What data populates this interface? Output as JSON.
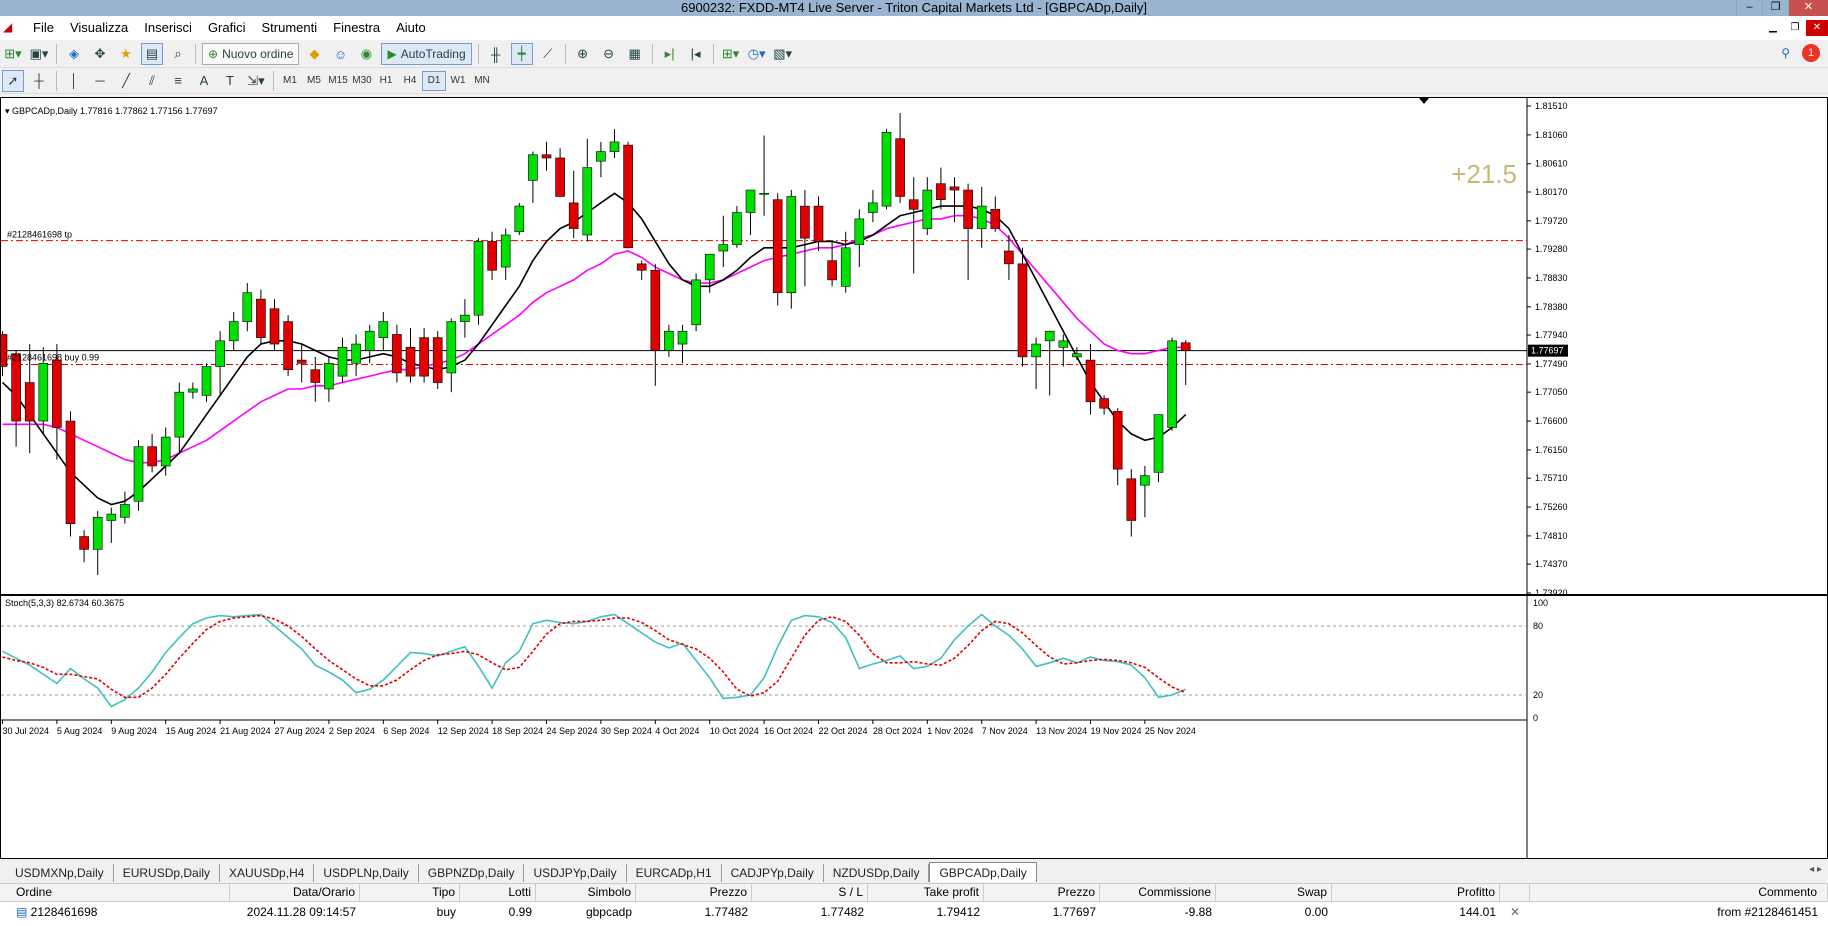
{
  "window": {
    "title": "6900232: FXDD-MT4 Live Server - Triton Capital Markets Ltd - [GBPCADp,Daily]",
    "controls": [
      "–",
      "❐",
      "✕"
    ]
  },
  "menu": {
    "items": [
      "File",
      "Visualizza",
      "Inserisci",
      "Grafici",
      "Strumenti",
      "Finestra",
      "Aiuto"
    ]
  },
  "toolbar": {
    "new_order_label": "Nuovo ordine",
    "autotrading_label": "AutoTrading",
    "timeframes": [
      "M1",
      "M5",
      "M15",
      "M30",
      "H1",
      "H4",
      "D1",
      "W1",
      "MN"
    ],
    "active_timeframe": "D1",
    "alert_count": "1"
  },
  "chart": {
    "header": "GBPCADp,Daily  1.77816 1.77862 1.77156 1.77697",
    "tp_label": "#2128461698 tp",
    "buy_label": "#2128461698 buy 0.99",
    "profit_label": "+21.5",
    "stoch_header": "Stoch(5,3,3) 82.6734 60.3675",
    "current_price": "1.77697",
    "price_labels": [
      "1.81510",
      "1.81060",
      "1.80610",
      "1.80170",
      "1.79720",
      "1.79280",
      "1.78830",
      "1.78380",
      "1.77940",
      "1.77490",
      "1.77050",
      "1.76600",
      "1.76150",
      "1.75710",
      "1.75260",
      "1.74810",
      "1.74370",
      "1.73920"
    ],
    "stoch_labels": [
      "100",
      "80",
      "20",
      "0"
    ],
    "date_labels": [
      "30 Jul 2024",
      "5 Aug 2024",
      "9 Aug 2024",
      "15 Aug 2024",
      "21 Aug 2024",
      "27 Aug 2024",
      "2 Sep 2024",
      "6 Sep 2024",
      "12 Sep 2024",
      "18 Sep 2024",
      "24 Sep 2024",
      "30 Sep 2024",
      "4 Oct 2024",
      "10 Oct 2024",
      "16 Oct 2024",
      "22 Oct 2024",
      "28 Oct 2024",
      "1 Nov 2024",
      "7 Nov 2024",
      "13 Nov 2024",
      "19 Nov 2024",
      "25 Nov 2024"
    ],
    "colors": {
      "bull": "#00e000",
      "bear": "#e00000",
      "ma_fast": "#000000",
      "ma_slow": "#ff00ff",
      "stoch_main": "#40c0c0",
      "stoch_signal": "#e00000",
      "trade_line": "#e00000",
      "profit_text": "#c8b878"
    }
  },
  "chart_data": {
    "type": "candlestick",
    "symbol": "GBPCADp",
    "timeframe": "Daily",
    "ylim": [
      1.7392,
      1.8151
    ],
    "tp_level": 1.79412,
    "entry_level": 1.77482,
    "current_price": 1.77697,
    "candles": [
      [
        1.7795,
        1.78,
        1.773,
        1.7745
      ],
      [
        1.7765,
        1.777,
        1.762,
        1.766
      ],
      [
        1.772,
        1.778,
        1.761,
        1.766
      ],
      [
        1.766,
        1.7775,
        1.764,
        1.775
      ],
      [
        1.7755,
        1.778,
        1.76,
        1.765
      ],
      [
        1.766,
        1.7675,
        1.748,
        1.75
      ],
      [
        1.748,
        1.749,
        1.744,
        1.746
      ],
      [
        1.746,
        1.752,
        1.742,
        1.751
      ],
      [
        1.7505,
        1.7525,
        1.747,
        1.7515
      ],
      [
        1.751,
        1.755,
        1.75,
        1.753
      ],
      [
        1.7535,
        1.763,
        1.752,
        1.762
      ],
      [
        1.762,
        1.764,
        1.758,
        1.759
      ],
      [
        1.759,
        1.765,
        1.7575,
        1.7635
      ],
      [
        1.7635,
        1.772,
        1.761,
        1.7705
      ],
      [
        1.7705,
        1.772,
        1.7695,
        1.771
      ],
      [
        1.77,
        1.775,
        1.769,
        1.7745
      ],
      [
        1.7745,
        1.78,
        1.77,
        1.7785
      ],
      [
        1.7785,
        1.783,
        1.777,
        1.7815
      ],
      [
        1.7815,
        1.7875,
        1.78,
        1.786
      ],
      [
        1.785,
        1.7865,
        1.778,
        1.779
      ],
      [
        1.7835,
        1.785,
        1.777,
        1.778
      ],
      [
        1.7815,
        1.7825,
        1.773,
        1.774
      ],
      [
        1.7755,
        1.778,
        1.772,
        1.775
      ],
      [
        1.774,
        1.776,
        1.769,
        1.772
      ],
      [
        1.771,
        1.776,
        1.769,
        1.775
      ],
      [
        1.773,
        1.779,
        1.772,
        1.7775
      ],
      [
        1.775,
        1.7795,
        1.773,
        1.778
      ],
      [
        1.777,
        1.781,
        1.775,
        1.78
      ],
      [
        1.779,
        1.783,
        1.777,
        1.7815
      ],
      [
        1.7795,
        1.781,
        1.772,
        1.7735
      ],
      [
        1.7775,
        1.7805,
        1.772,
        1.773
      ],
      [
        1.779,
        1.7805,
        1.772,
        1.773
      ],
      [
        1.779,
        1.78,
        1.771,
        1.772
      ],
      [
        1.7735,
        1.782,
        1.7705,
        1.7815
      ],
      [
        1.7815,
        1.785,
        1.779,
        1.7825
      ],
      [
        1.7825,
        1.7945,
        1.781,
        1.794
      ],
      [
        1.794,
        1.7955,
        1.788,
        1.7895
      ],
      [
        1.79,
        1.796,
        1.788,
        1.795
      ],
      [
        1.7955,
        1.8,
        1.795,
        1.7995
      ],
      [
        1.8035,
        1.808,
        1.8,
        1.8075
      ],
      [
        1.8075,
        1.8095,
        1.805,
        1.807
      ],
      [
        1.807,
        1.8085,
        1.801,
        1.801
      ],
      [
        1.8,
        1.805,
        1.7945,
        1.796
      ],
      [
        1.795,
        1.81,
        1.794,
        1.8055
      ],
      [
        1.8065,
        1.8095,
        1.804,
        1.808
      ],
      [
        1.808,
        1.8115,
        1.807,
        1.8095
      ],
      [
        1.809,
        1.8095,
        1.793,
        1.793
      ],
      [
        1.7905,
        1.791,
        1.788,
        1.7895
      ],
      [
        1.7895,
        1.7905,
        1.7715,
        1.777
      ],
      [
        1.777,
        1.781,
        1.776,
        1.78
      ],
      [
        1.778,
        1.781,
        1.775,
        1.78
      ],
      [
        1.781,
        1.789,
        1.78,
        1.788
      ],
      [
        1.788,
        1.792,
        1.786,
        1.792
      ],
      [
        1.7925,
        1.798,
        1.79,
        1.7935
      ],
      [
        1.7935,
        1.7995,
        1.793,
        1.7985
      ],
      [
        1.7985,
        1.802,
        1.795,
        1.802
      ],
      [
        1.8015,
        1.8105,
        1.798,
        1.8015
      ],
      [
        1.8005,
        1.8015,
        1.784,
        1.786
      ],
      [
        1.786,
        1.802,
        1.7835,
        1.801
      ],
      [
        1.7995,
        1.802,
        1.787,
        1.7945
      ],
      [
        1.7995,
        1.801,
        1.7925,
        1.794
      ],
      [
        1.791,
        1.794,
        1.787,
        1.788
      ],
      [
        1.787,
        1.7955,
        1.786,
        1.793
      ],
      [
        1.7935,
        1.799,
        1.79,
        1.7975
      ],
      [
        1.7985,
        1.802,
        1.797,
        1.8
      ],
      [
        1.7995,
        1.8115,
        1.799,
        1.811
      ],
      [
        1.81,
        1.814,
        1.8,
        1.801
      ],
      [
        1.8005,
        1.804,
        1.789,
        1.799
      ],
      [
        1.796,
        1.804,
        1.795,
        1.802
      ],
      [
        1.803,
        1.8055,
        1.799,
        1.8005
      ],
      [
        1.8025,
        1.804,
        1.797,
        1.802
      ],
      [
        1.802,
        1.803,
        1.788,
        1.796
      ],
      [
        1.796,
        1.8025,
        1.793,
        1.7995
      ],
      [
        1.799,
        1.801,
        1.7955,
        1.796
      ],
      [
        1.7925,
        1.795,
        1.788,
        1.7905
      ],
      [
        1.7905,
        1.793,
        1.7745,
        1.776
      ],
      [
        1.776,
        1.779,
        1.771,
        1.778
      ],
      [
        1.7785,
        1.78,
        1.77,
        1.78
      ],
      [
        1.7775,
        1.7795,
        1.7745,
        1.7785
      ],
      [
        1.776,
        1.7775,
        1.7755,
        1.7765
      ],
      [
        1.7755,
        1.778,
        1.767,
        1.769
      ],
      [
        1.7695,
        1.77,
        1.767,
        1.768
      ],
      [
        1.7675,
        1.768,
        1.756,
        1.7585
      ],
      [
        1.757,
        1.7585,
        1.748,
        1.7505
      ],
      [
        1.756,
        1.759,
        1.751,
        1.7575
      ],
      [
        1.758,
        1.767,
        1.7565,
        1.767
      ],
      [
        1.765,
        1.779,
        1.7645,
        1.7785
      ],
      [
        1.7782,
        1.7786,
        1.7716,
        1.777
      ]
    ],
    "ma_fast": [
      1.772,
      1.77,
      1.767,
      1.764,
      1.761,
      1.758,
      1.756,
      1.754,
      1.753,
      1.7535,
      1.755,
      1.757,
      1.759,
      1.761,
      1.764,
      1.767,
      1.77,
      1.773,
      1.776,
      1.778,
      1.7785,
      1.7785,
      1.778,
      1.777,
      1.776,
      1.7755,
      1.7755,
      1.776,
      1.7765,
      1.776,
      1.775,
      1.7745,
      1.774,
      1.7745,
      1.7755,
      1.778,
      1.781,
      1.784,
      1.787,
      1.791,
      1.794,
      1.796,
      1.797,
      1.7985,
      1.8,
      1.8015,
      1.8,
      1.7975,
      1.794,
      1.7905,
      1.788,
      1.787,
      1.787,
      1.788,
      1.7895,
      1.7915,
      1.793,
      1.793,
      1.793,
      1.7935,
      1.794,
      1.794,
      1.7935,
      1.794,
      1.795,
      1.7965,
      1.798,
      1.7985,
      1.799,
      1.7995,
      1.7995,
      1.7995,
      1.799,
      1.798,
      1.796,
      1.792,
      1.788,
      1.784,
      1.78,
      1.776,
      1.772,
      1.769,
      1.766,
      1.764,
      1.763,
      1.7635,
      1.765,
      1.767
    ],
    "ma_slow": [
      1.7655,
      1.7655,
      1.7655,
      1.7655,
      1.765,
      1.764,
      1.763,
      1.762,
      1.761,
      1.76,
      1.7595,
      1.7595,
      1.76,
      1.761,
      1.762,
      1.763,
      1.7645,
      1.766,
      1.7675,
      1.769,
      1.77,
      1.771,
      1.771,
      1.7715,
      1.7715,
      1.772,
      1.7725,
      1.773,
      1.7735,
      1.774,
      1.774,
      1.7745,
      1.775,
      1.7755,
      1.7765,
      1.778,
      1.7795,
      1.781,
      1.7825,
      1.7845,
      1.786,
      1.787,
      1.788,
      1.7895,
      1.7905,
      1.792,
      1.7925,
      1.7915,
      1.79,
      1.789,
      1.788,
      1.7875,
      1.7875,
      1.788,
      1.789,
      1.79,
      1.791,
      1.7915,
      1.792,
      1.7925,
      1.793,
      1.793,
      1.7935,
      1.7945,
      1.795,
      1.796,
      1.7965,
      1.797,
      1.7975,
      1.7975,
      1.798,
      1.798,
      1.7975,
      1.7965,
      1.7945,
      1.792,
      1.7895,
      1.787,
      1.7845,
      1.782,
      1.78,
      1.778,
      1.777,
      1.7765,
      1.7765,
      1.777,
      1.7775,
      1.7775
    ],
    "stoch_main": [
      58,
      52,
      46,
      38,
      30,
      43,
      34,
      26,
      10,
      16,
      26,
      40,
      57,
      70,
      82,
      87,
      89,
      88,
      89,
      90,
      80,
      70,
      60,
      46,
      40,
      33,
      22,
      25,
      33,
      45,
      57,
      56,
      54,
      58,
      62,
      45,
      26,
      48,
      58,
      82,
      85,
      83,
      82,
      84,
      88,
      90,
      82,
      74,
      66,
      61,
      65,
      50,
      35,
      17,
      18,
      20,
      35,
      62,
      85,
      89,
      88,
      83,
      70,
      43,
      47,
      50,
      54,
      43,
      45,
      52,
      68,
      80,
      90,
      80,
      72,
      60,
      45,
      48,
      52,
      48,
      53,
      50,
      49,
      46,
      35,
      18,
      20,
      25
    ],
    "stoch_signal": [
      53,
      50,
      48,
      44,
      38,
      38,
      36,
      34,
      25,
      18,
      18,
      26,
      38,
      52,
      65,
      77,
      84,
      87,
      88,
      89,
      86,
      80,
      71,
      60,
      50,
      42,
      34,
      28,
      28,
      33,
      42,
      50,
      55,
      56,
      58,
      55,
      48,
      42,
      44,
      58,
      73,
      82,
      84,
      84,
      85,
      87,
      87,
      83,
      76,
      68,
      64,
      60,
      52,
      40,
      25,
      19,
      22,
      32,
      52,
      72,
      85,
      88,
      84,
      72,
      56,
      48,
      48,
      49,
      47,
      46,
      52,
      63,
      76,
      84,
      82,
      74,
      63,
      53,
      47,
      48,
      50,
      51,
      50,
      48,
      44,
      35,
      27,
      22
    ]
  },
  "symbol_tabs": {
    "items": [
      "USDMXNp,Daily",
      "EURUSDp,Daily",
      "XAUUSDp,H4",
      "USDPLNp,Daily",
      "GBPNZDp,Daily",
      "USDJPYp,Daily",
      "EURCADp,H1",
      "CADJPYp,Daily",
      "NZDUSDp,Daily",
      "GBPCADp,Daily"
    ],
    "active": "GBPCADp,Daily"
  },
  "terminal": {
    "headers": {
      "ordine": "Ordine",
      "data": "Data/Orario",
      "tipo": "Tipo",
      "lotti": "Lotti",
      "simbolo": "Simbolo",
      "prezzo": "Prezzo",
      "sl": "S / L",
      "tp": "Take profit",
      "prezzo2": "Prezzo",
      "commissione": "Commissione",
      "swap": "Swap",
      "profitto": "Profitto",
      "commento": "Commento"
    },
    "row": {
      "ordine": "2128461698",
      "data": "2024.11.28 09:14:57",
      "tipo": "buy",
      "lotti": "0.99",
      "simbolo": "gbpcadp",
      "prezzo": "1.77482",
      "sl": "1.77482",
      "tp": "1.79412",
      "prezzo2": "1.77697",
      "commissione": "-9.88",
      "swap": "0.00",
      "profitto": "144.01",
      "commento": "from #2128461451"
    }
  }
}
